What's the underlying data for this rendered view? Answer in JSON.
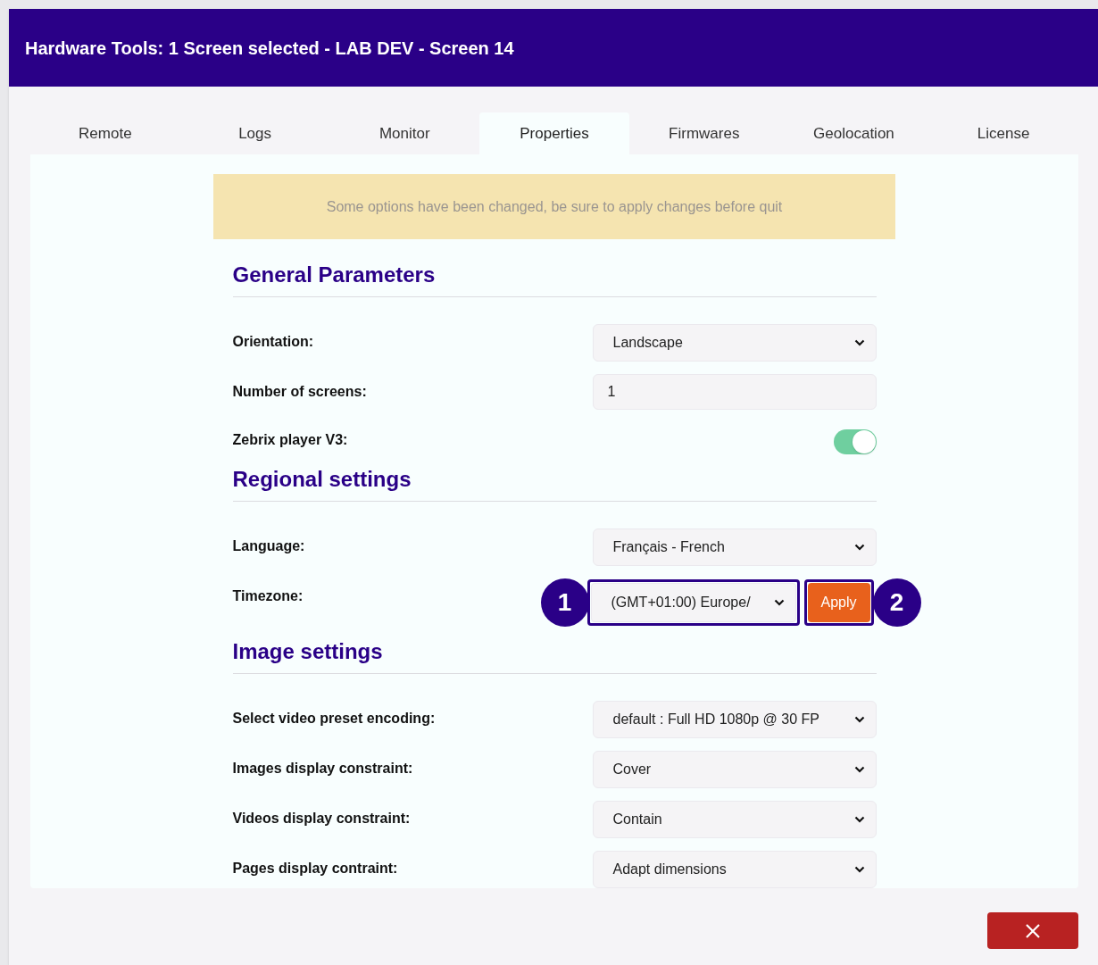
{
  "window": {
    "title": "Hardware Tools: 1 Screen selected - LAB DEV - Screen 14"
  },
  "tabs": [
    {
      "label": "Remote",
      "selected": false
    },
    {
      "label": "Logs",
      "selected": false
    },
    {
      "label": "Monitor",
      "selected": false
    },
    {
      "label": "Properties",
      "selected": true
    },
    {
      "label": "Firmwares",
      "selected": false
    },
    {
      "label": "Geolocation",
      "selected": false
    },
    {
      "label": "License",
      "selected": false
    }
  ],
  "banner": {
    "text": "Some options have been changed, be sure to apply changes before quit"
  },
  "sections": [
    {
      "title": "General Parameters",
      "fields": [
        {
          "kind": "select",
          "label": "Orientation:",
          "value": "Landscape"
        },
        {
          "kind": "input",
          "label": "Number of screens:",
          "value": "1"
        },
        {
          "kind": "toggle",
          "label": "Zebrix player V3:",
          "on": true
        }
      ]
    },
    {
      "title": "Regional settings",
      "fields": [
        {
          "kind": "select",
          "label": "Language:",
          "value": "Français - French"
        },
        {
          "kind": "select_apply",
          "label": "Timezone:",
          "value": "(GMT+01:00) Europe/",
          "button": "Apply",
          "badges": [
            "1",
            "2"
          ]
        }
      ]
    },
    {
      "title": "Image settings",
      "fields": [
        {
          "kind": "select",
          "label": "Select video preset encoding:",
          "value": "default : Full HD 1080p @ 30 FP"
        },
        {
          "kind": "select",
          "label": "Images display constraint:",
          "value": "Cover"
        },
        {
          "kind": "select",
          "label": "Videos display constraint:",
          "value": "Contain"
        },
        {
          "kind": "select",
          "label": "Pages display contraint:",
          "value": "Adapt dimensions"
        }
      ]
    }
  ]
}
